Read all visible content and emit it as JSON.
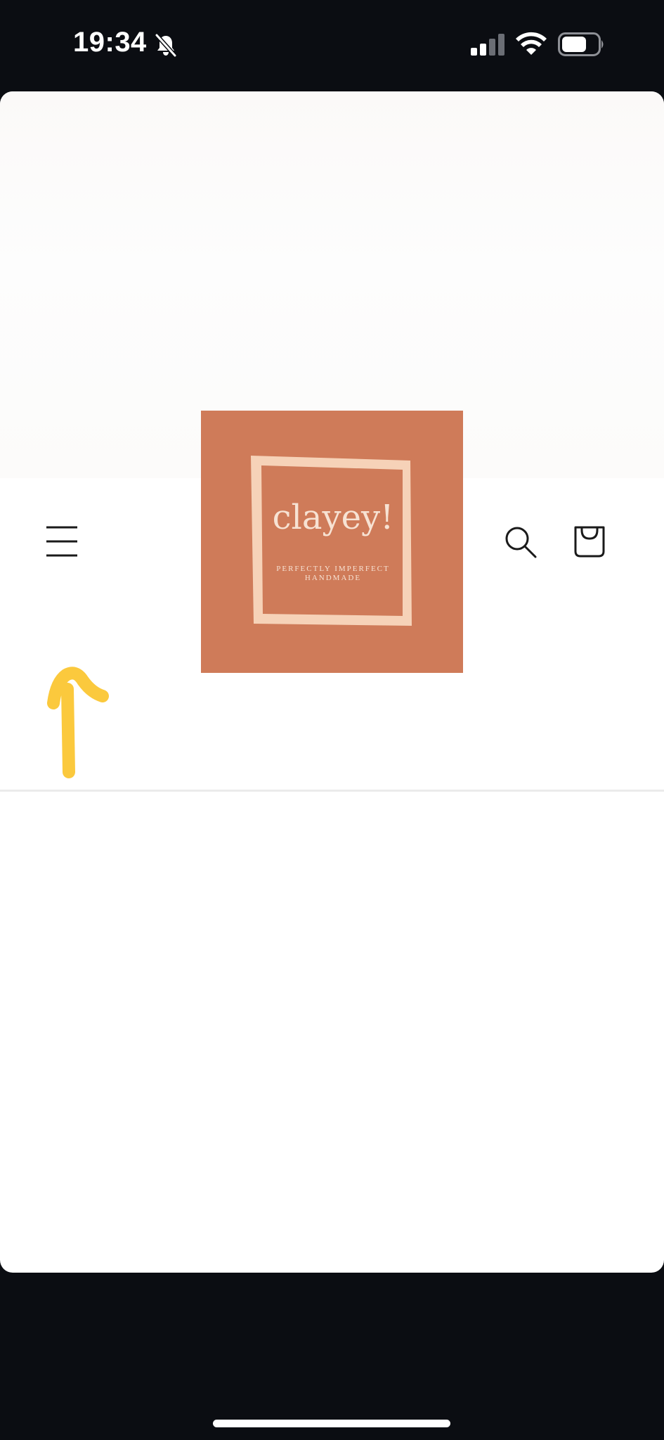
{
  "status_bar": {
    "time": "19:34",
    "icons": [
      "bell-off-icon",
      "signal-icon",
      "wifi-icon",
      "battery-icon"
    ]
  },
  "header": {
    "menu_icon": "hamburger-menu-icon",
    "search_icon": "search-icon",
    "cart_icon": "shopping-bag-icon"
  },
  "logo": {
    "name": "clayey!",
    "tagline_line1": "PERFECTLY IMPERFECT",
    "tagline_line2": "HANDMADE",
    "background_color": "#cf7b59",
    "frame_color": "#f6d2b8",
    "text_color": "#f7e2d3"
  },
  "annotation": {
    "arrow_color": "#fbc93d"
  }
}
